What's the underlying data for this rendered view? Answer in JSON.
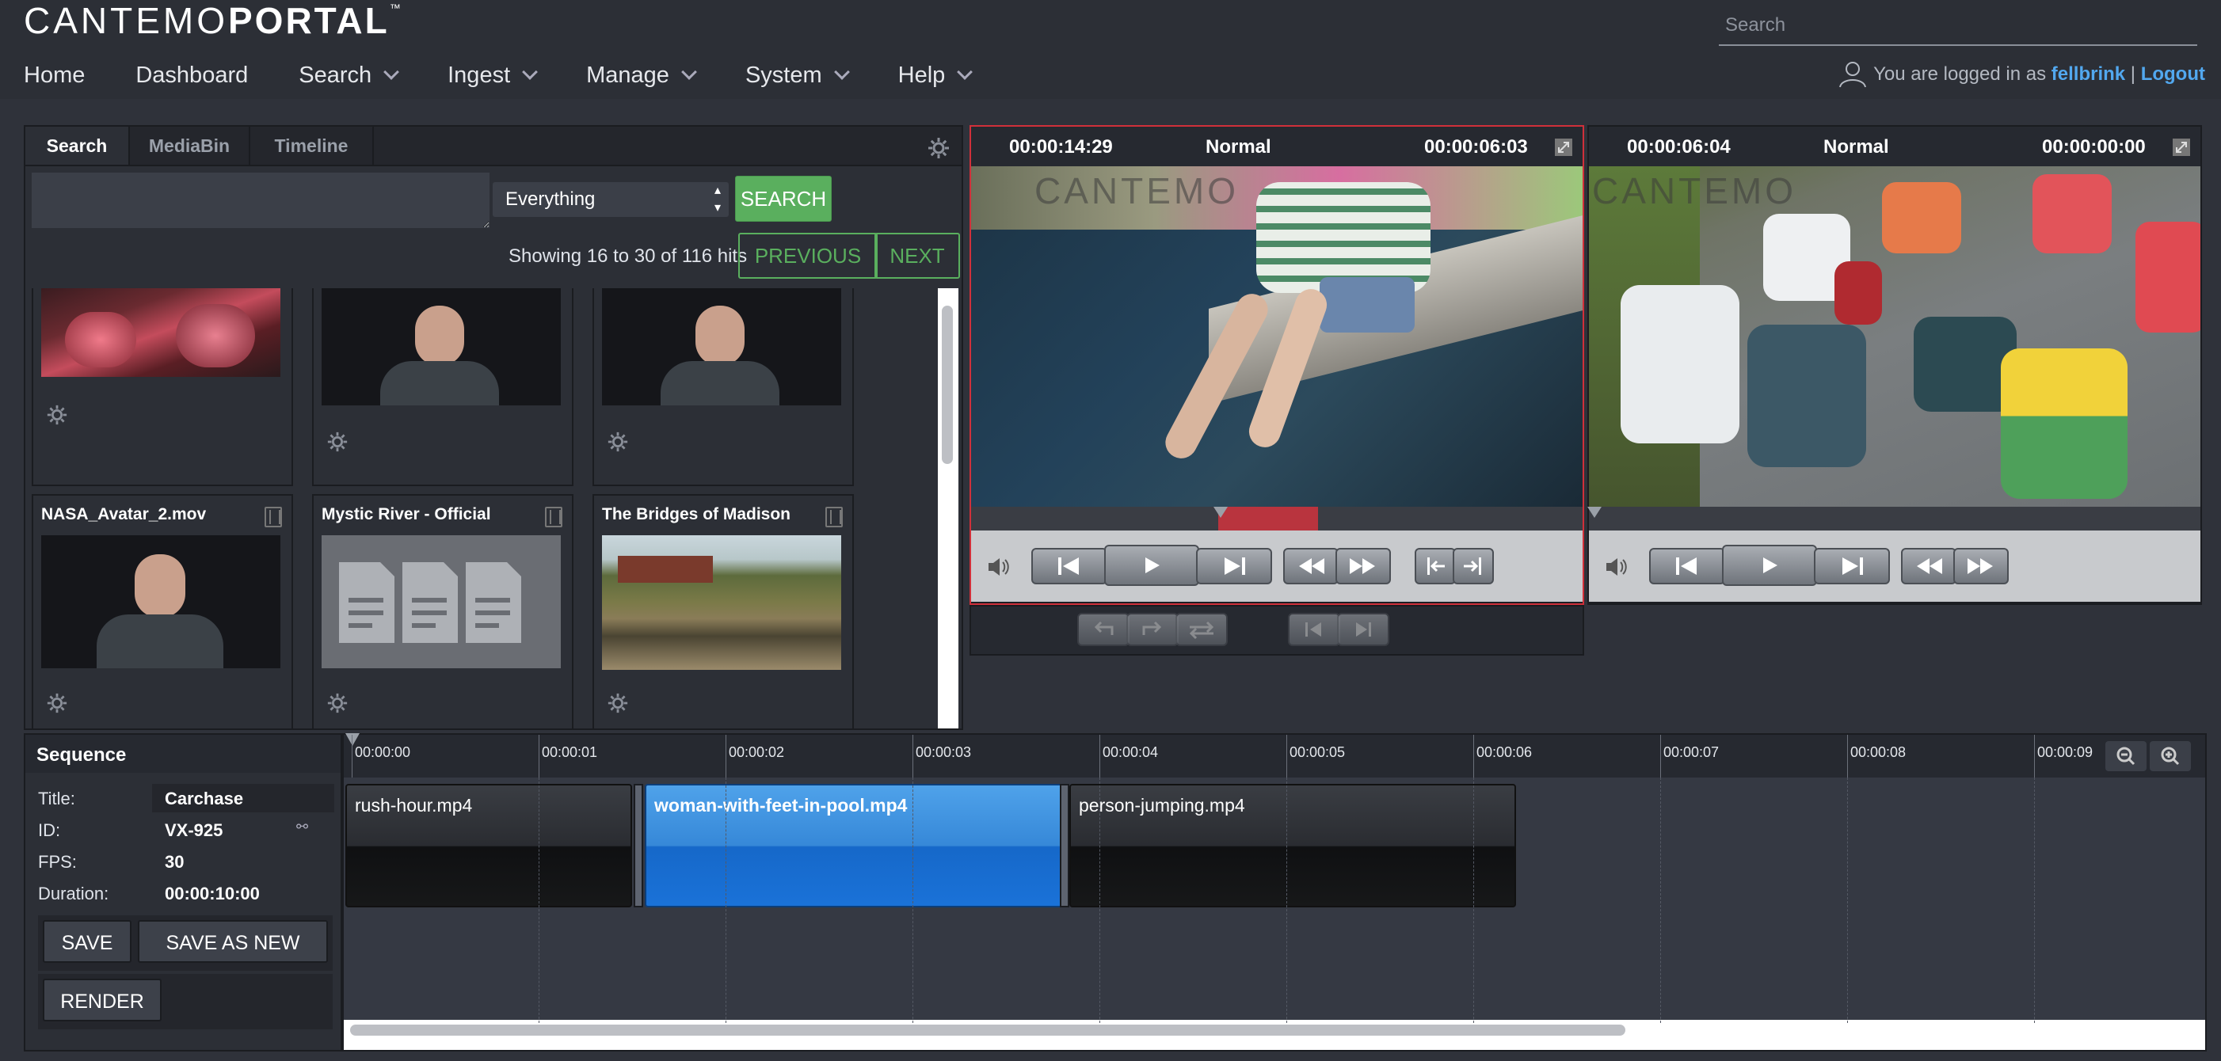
{
  "brand": {
    "logo_thin": "CANTEMO",
    "logo_bold": "PORTAL",
    "logo_tm": "™"
  },
  "header": {
    "search_placeholder": "Search",
    "nav": [
      {
        "label": "Home",
        "dropdown": false
      },
      {
        "label": "Dashboard",
        "dropdown": false
      },
      {
        "label": "Search",
        "dropdown": true
      },
      {
        "label": "Ingest",
        "dropdown": true
      },
      {
        "label": "Manage",
        "dropdown": true
      },
      {
        "label": "System",
        "dropdown": true
      },
      {
        "label": "Help",
        "dropdown": true
      }
    ],
    "user": {
      "prefix": "You are logged in as",
      "username": "fellbrink",
      "separator": "|",
      "logout": "Logout"
    }
  },
  "search_panel": {
    "tabs": [
      "Search",
      "MediaBin",
      "Timeline"
    ],
    "active_tab": "Search",
    "query": "",
    "scope": "Everything",
    "search_button": "SEARCH",
    "hits": "Showing 16 to 30 of 116 hits",
    "previous": "PREVIOUS",
    "next": "NEXT",
    "results": [
      {
        "title": "",
        "thumb": "red-machinery"
      },
      {
        "title": "",
        "thumb": "man-speaking"
      },
      {
        "title": "",
        "thumb": "man-speaking"
      },
      {
        "title": "NASA_Avatar_2.mov",
        "thumb": "man-speaking",
        "film_icon": true
      },
      {
        "title": "Mystic River - Official",
        "thumb": "document-placeholder",
        "film_icon": true
      },
      {
        "title": "The Bridges of Madison",
        "thumb": "bridge-landscape",
        "film_icon": true
      }
    ]
  },
  "player_left": {
    "timecode_in": "00:00:14:29",
    "speed": "Normal",
    "timecode_out": "00:00:06:03",
    "watermark": "CANTEMO"
  },
  "player_right": {
    "timecode_in": "00:00:06:04",
    "speed": "Normal",
    "timecode_out": "00:00:00:00",
    "watermark": "CANTEMO"
  },
  "sequence": {
    "heading": "Sequence",
    "fields": [
      {
        "key": "Title:",
        "value": "Carchase"
      },
      {
        "key": "ID:",
        "value": "VX-925"
      },
      {
        "key": "FPS:",
        "value": "30"
      },
      {
        "key": "Duration:",
        "value": "00:00:10:00"
      }
    ],
    "save": "SAVE",
    "save_as_new": "SAVE AS NEW",
    "render": "RENDER"
  },
  "timeline": {
    "ticks": [
      "00:00:00",
      "00:00:01",
      "00:00:02",
      "00:00:03",
      "00:00:04",
      "00:00:05",
      "00:00:06",
      "00:00:07",
      "00:00:08",
      "00:00:09"
    ],
    "clips": [
      {
        "name": "rush-hour.mp4",
        "selected": false
      },
      {
        "name": "woman-with-feet-in-pool.mp4",
        "selected": true
      },
      {
        "name": "person-jumping.mp4",
        "selected": false
      }
    ]
  },
  "colors": {
    "accent_green": "#5aaf5e",
    "link_blue": "#52a8ef",
    "selected_clip": "#2a80d6",
    "active_player_border": "#d0303a"
  }
}
